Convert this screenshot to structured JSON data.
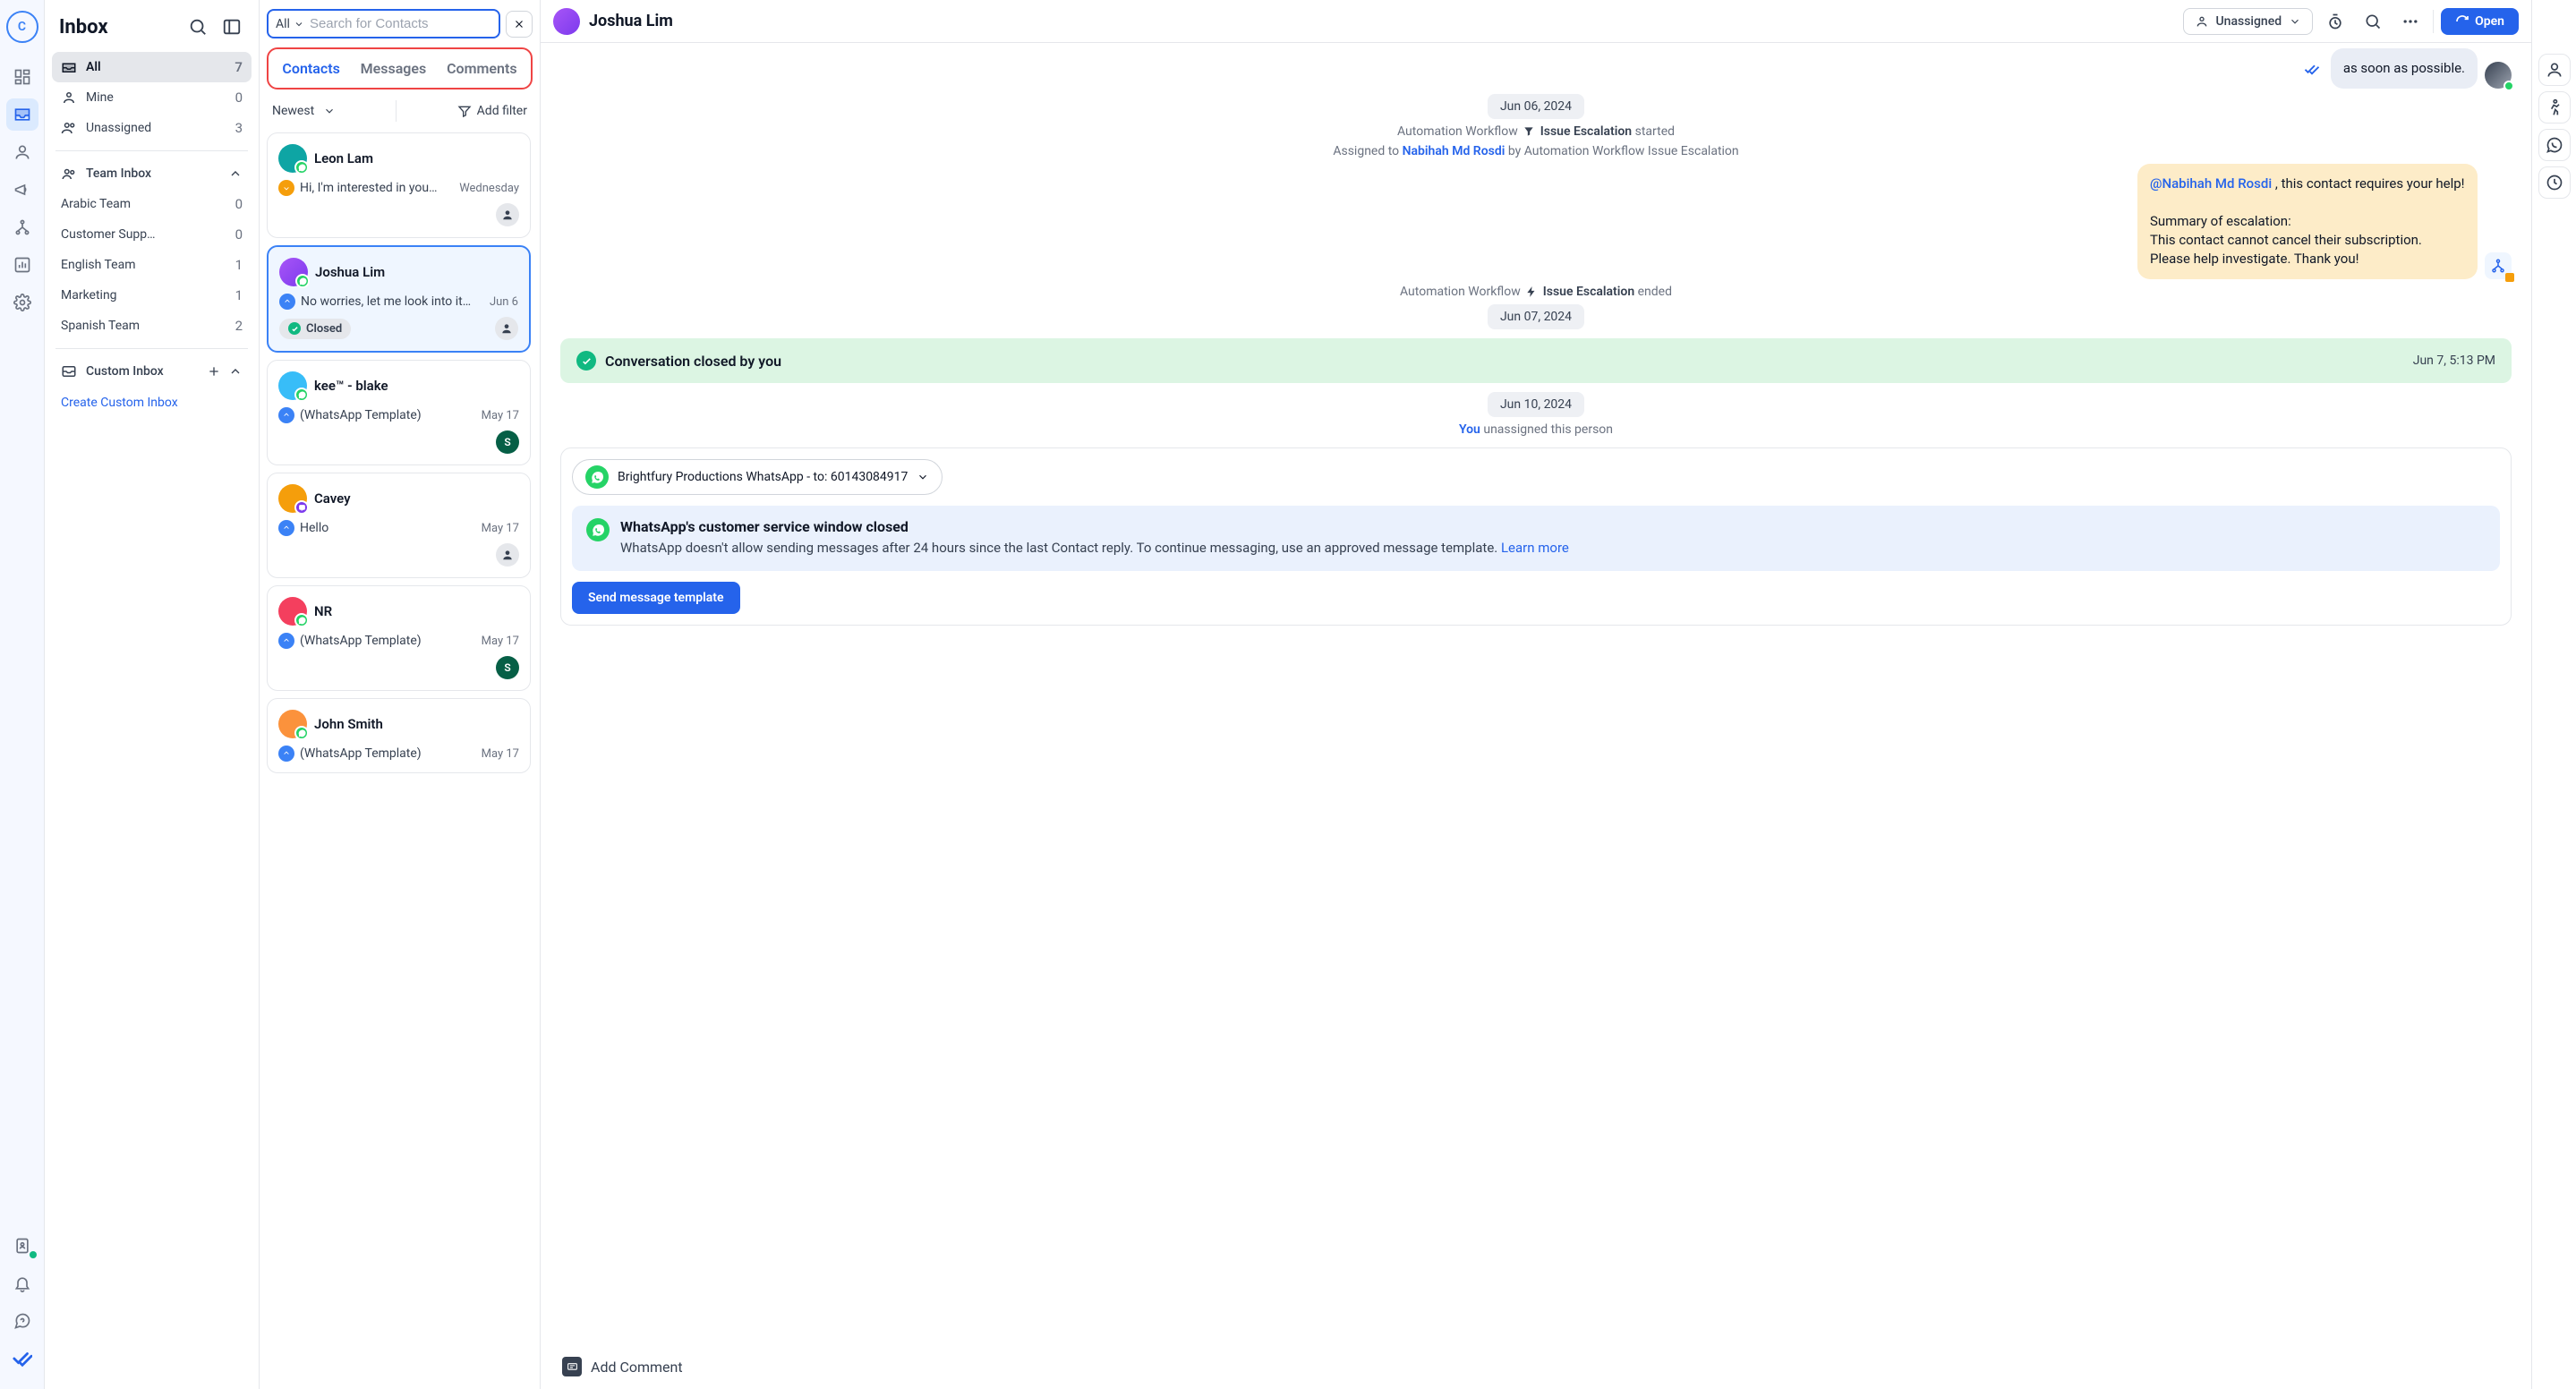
{
  "rail": {
    "logo_letter": "C"
  },
  "sidebar": {
    "title": "Inbox",
    "items": [
      {
        "label": "All",
        "count": "7"
      },
      {
        "label": "Mine",
        "count": "0"
      },
      {
        "label": "Unassigned",
        "count": "3"
      }
    ],
    "team_section": "Team Inbox",
    "teams": [
      {
        "label": "Arabic Team",
        "count": "0"
      },
      {
        "label": "Customer Supp…",
        "count": "0"
      },
      {
        "label": "English Team",
        "count": "1"
      },
      {
        "label": "Marketing",
        "count": "1"
      },
      {
        "label": "Spanish Team",
        "count": "2"
      }
    ],
    "custom_section": "Custom Inbox",
    "create_link": "Create Custom Inbox"
  },
  "search": {
    "scope": "All",
    "placeholder": "Search for Contacts"
  },
  "tabs": {
    "contacts": "Contacts",
    "messages": "Messages",
    "comments": "Comments"
  },
  "sort": {
    "label": "Newest",
    "add_filter": "Add filter"
  },
  "cards": [
    {
      "name": "Leon Lam",
      "preview": "Hi, I'm interested in you…",
      "date": "Wednesday",
      "dir": "in",
      "avatar_bg": "#0ea5a4"
    },
    {
      "name": "Joshua Lim",
      "preview": "No worries, let me look into it…",
      "date": "Jun 6",
      "dir": "out",
      "closed": "Closed",
      "avatar_bg": "#a855f7"
    },
    {
      "name": "kee™ - blake",
      "preview": "(WhatsApp Template)",
      "date": "May 17",
      "dir": "out",
      "assignee_letter": "S",
      "assignee_bg": "#065f46",
      "avatar_bg": "#38bdf8"
    },
    {
      "name": "Cavey",
      "preview": "Hello",
      "date": "May 17",
      "dir": "out",
      "avatar_bg": "#f59e0b",
      "badge": "viber"
    },
    {
      "name": "NR",
      "preview": "(WhatsApp Template)",
      "date": "May 17",
      "dir": "out",
      "assignee_letter": "S",
      "assignee_bg": "#065f46",
      "avatar_bg": "#f43f5e"
    },
    {
      "name": "John Smith",
      "preview": "(WhatsApp Template)",
      "date": "May 17",
      "dir": "out",
      "avatar_bg": "#fb923c"
    }
  ],
  "main": {
    "title": "Joshua Lim",
    "unassigned": "Unassigned",
    "open": "Open",
    "msg_top": "as soon as possible.",
    "date1": "Jun 06, 2024",
    "wf_started_pre": "Automation Workflow",
    "wf_name": "Issue Escalation",
    "wf_started_suf": "started",
    "assigned_pre": "Assigned to ",
    "assigned_name": "Nabihah Md Rosdi",
    "assigned_suf": " by Automation Workflow Issue Escalation",
    "esc_mention": "@Nabihah Md Rosdi",
    "esc_l1": " , this contact requires your help!",
    "esc_l2": "Summary of escalation:",
    "esc_l3": "This contact cannot cancel their subscription. Please help investigate. Thank you!",
    "wf_ended_pre": "Automation Workflow",
    "wf_ended_suf": "ended",
    "date2": "Jun 07, 2024",
    "closed_pre": "Conversation closed by ",
    "closed_by": "you",
    "closed_time": "Jun 7, 5:13 PM",
    "date3": "Jun 10, 2024",
    "unassign_you": "You",
    "unassign_suf": " unassigned this person",
    "channel": "Brightfury Productions WhatsApp - to: 60143084917",
    "info_title": "WhatsApp's customer service window closed",
    "info_text": "WhatsApp doesn't allow sending messages after 24 hours since the last Contact reply. To continue messaging, use an approved message template. ",
    "learn_more": "Learn more",
    "send_template": "Send message template",
    "add_comment": "Add Comment"
  }
}
